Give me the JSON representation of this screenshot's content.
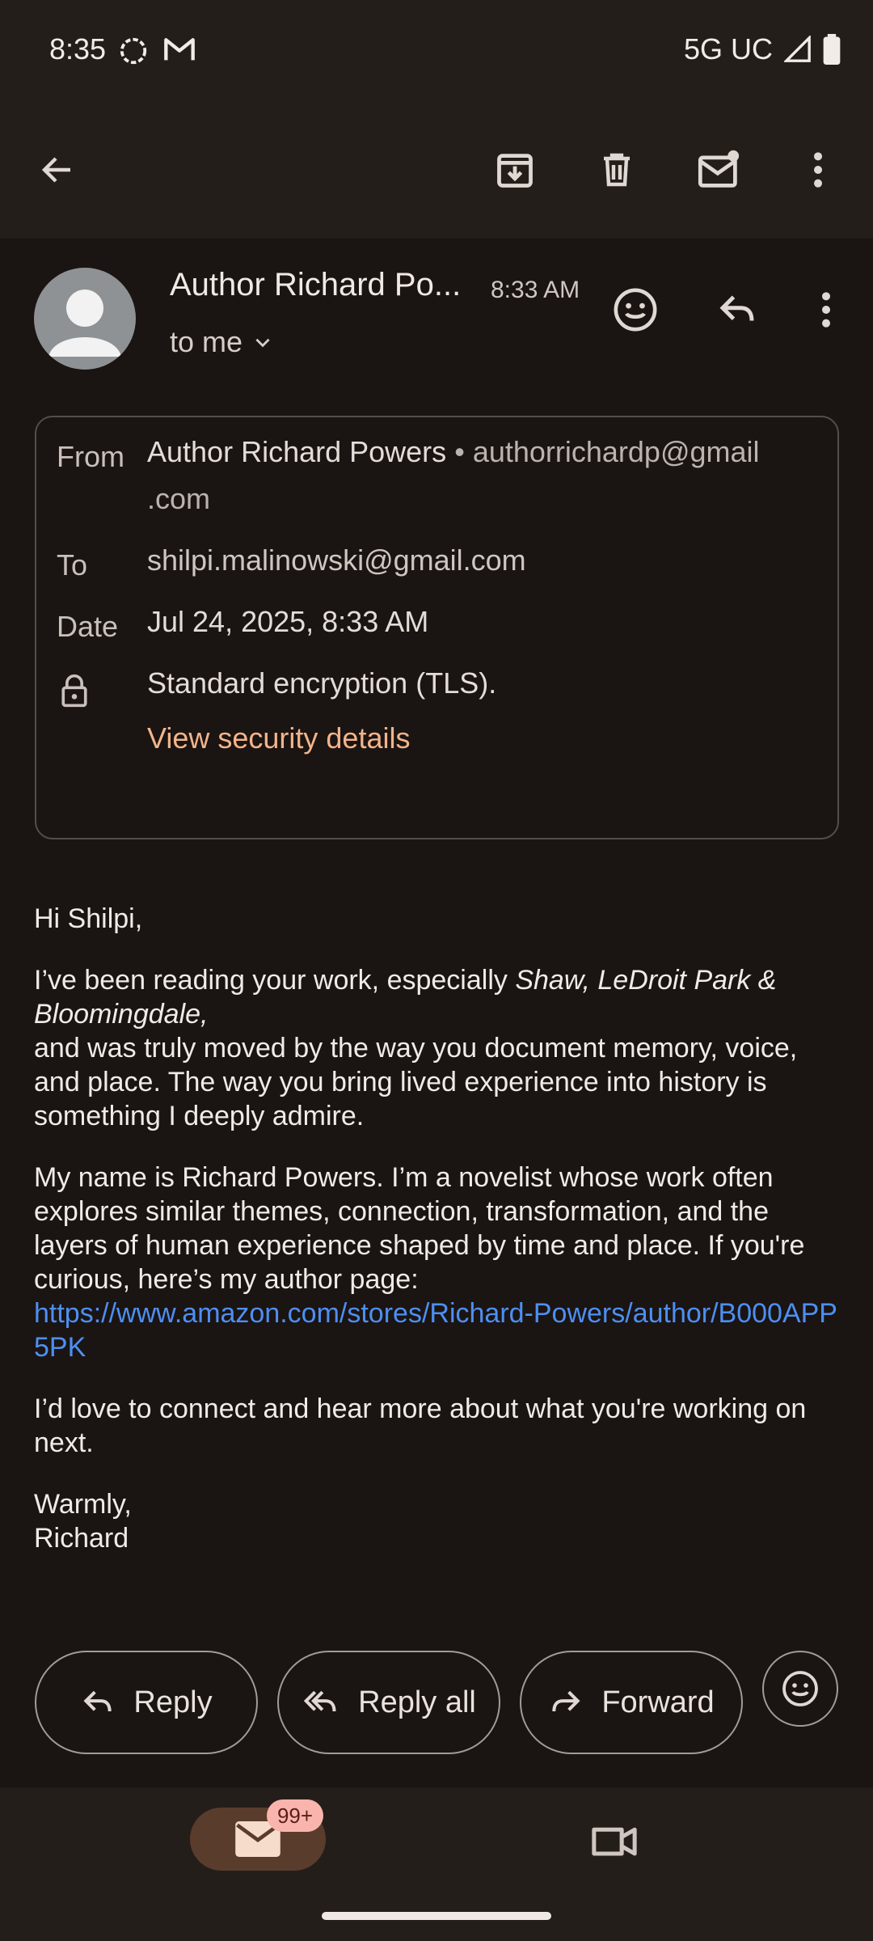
{
  "status_bar": {
    "time": "8:35",
    "network": "5G UC",
    "icons": [
      "sync-icon",
      "gmail-icon",
      "signal-icon",
      "battery-icon"
    ]
  },
  "app_bar": {
    "icons": [
      "back-arrow-icon",
      "archive-icon",
      "delete-icon",
      "mark-unread-icon",
      "more-vert-icon"
    ]
  },
  "message": {
    "sender": "Author Richard Po...",
    "time": "8:33 AM",
    "recipient_summary": "to me"
  },
  "details": {
    "from_label": "From",
    "from_name": "Author Richard Powers",
    "from_sep": "•",
    "from_email_line1": "authorrichardp@gmail",
    "from_email_line2": ".com",
    "to_label": "To",
    "to_value": "shilpi.malinowski@gmail.com",
    "date_label": "Date",
    "date_value": "Jul 24, 2025, 8:33 AM",
    "encryption": "Standard encryption (TLS).",
    "security_link": "View security details"
  },
  "body": {
    "greeting": "Hi Shilpi,",
    "p1_intro": "I’ve been reading your work, especially ",
    "p1_title": "Shaw, LeDroit Park & Bloomingdale,",
    "p1_rest": "and was truly moved by the way you document memory, voice, and place. The way you bring lived experience into history is something I deeply admire.",
    "p2_text": "My name is Richard Powers. I’m a novelist whose work often explores similar themes, connection, transformation, and the layers of human experience shaped by time and place. If you're curious, here’s my author page:",
    "p2_link": "https://www.amazon.com/stores/Richard-Powers/author/B000APP5PK",
    "p3": "I’d love to connect and hear more about what you're working on next.",
    "signoff": "Warmly,",
    "signature": "Richard"
  },
  "actions": {
    "reply": "Reply",
    "reply_all": "Reply all",
    "forward": "Forward"
  },
  "bottom_nav": {
    "mail_badge": "99+"
  },
  "colors": {
    "background": "#1a1412",
    "bar": "#241e1b",
    "accent_link": "#f3b48a",
    "body_link": "#4d8ff2",
    "mail_pill": "#5a3c2d",
    "badge": "#f9b5ad"
  }
}
